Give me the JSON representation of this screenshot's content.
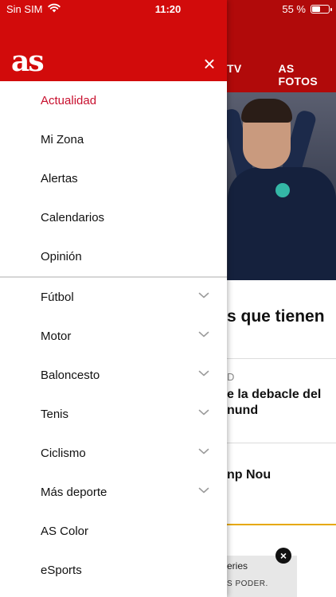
{
  "status_bar": {
    "carrier": "Sin SIM",
    "time": "11:20",
    "battery_label": "55 %",
    "battery_level": 0.55
  },
  "background": {
    "tabs": [
      "TV",
      "AS FOTOS"
    ],
    "headline": "s que tienen",
    "kicker": "D",
    "story2_line1": "e la debacle del",
    "story2_line2": "nund",
    "story3": "np Nou",
    "ad_brand": "eries",
    "ad_tagline": "S PODER.",
    "ad_close_label": "×"
  },
  "drawer": {
    "logo": "as",
    "close_icon": "close-icon",
    "close_label": "×",
    "colors": {
      "header": "#d20b0b",
      "active": "#c8102e"
    },
    "primary_items": [
      {
        "label": "Actualidad",
        "active": true
      },
      {
        "label": "Mi Zona",
        "active": false
      },
      {
        "label": "Alertas",
        "active": false
      },
      {
        "label": "Calendarios",
        "active": false
      },
      {
        "label": "Opinión",
        "active": false
      }
    ],
    "sections": [
      {
        "label": "Fútbol",
        "expandable": true
      },
      {
        "label": "Motor",
        "expandable": true
      },
      {
        "label": "Baloncesto",
        "expandable": true
      },
      {
        "label": "Tenis",
        "expandable": true
      },
      {
        "label": "Ciclismo",
        "expandable": true
      },
      {
        "label": "Más deporte",
        "expandable": true
      },
      {
        "label": "AS Color",
        "expandable": false
      },
      {
        "label": "eSports",
        "expandable": false
      }
    ]
  }
}
